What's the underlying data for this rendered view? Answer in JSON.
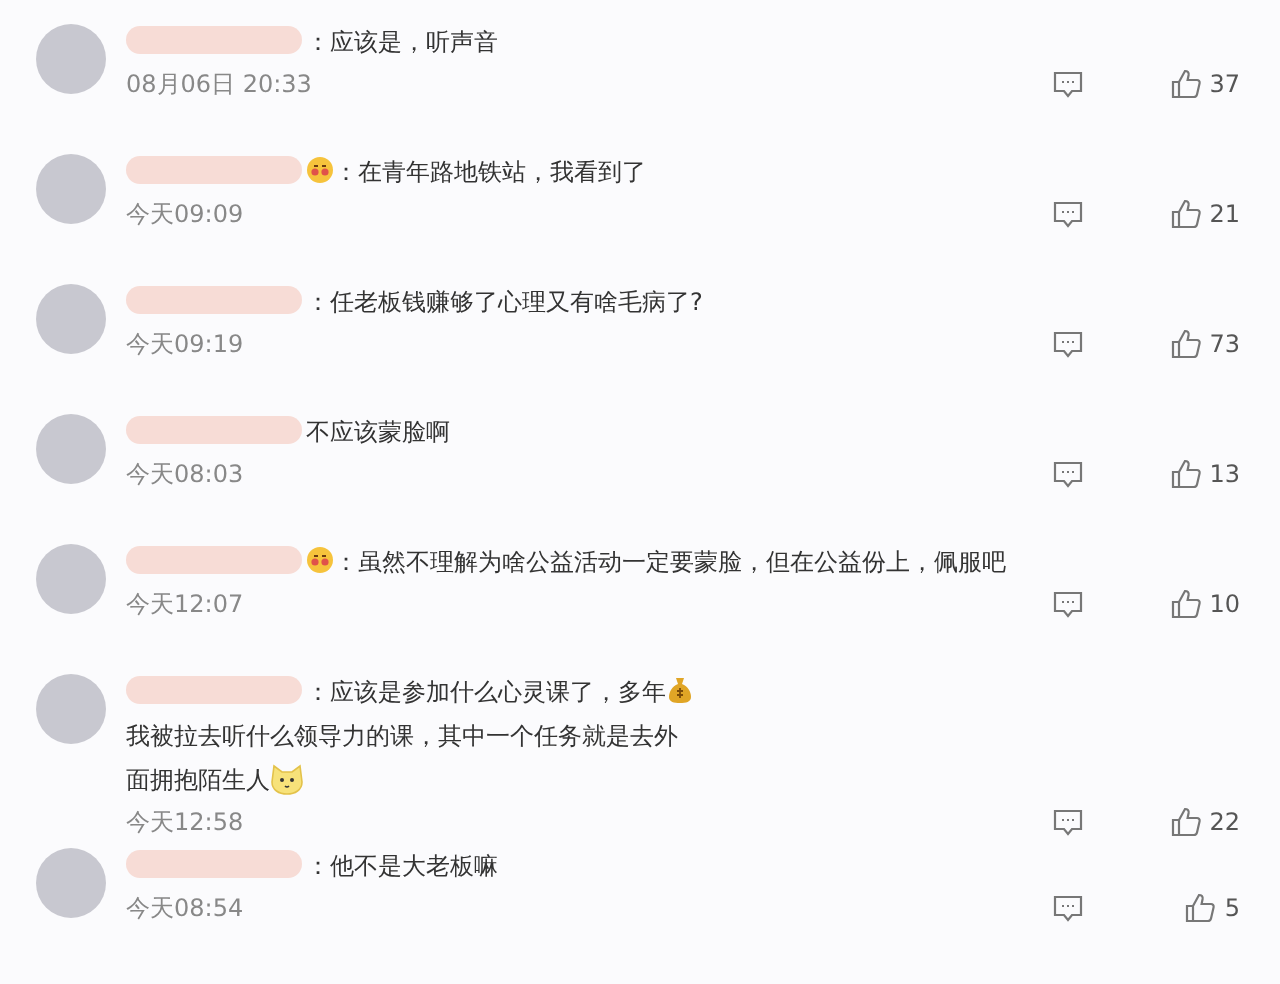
{
  "comments": [
    {
      "body": [
        {
          "kind": "text",
          "text": "：应该是，听声音"
        }
      ],
      "time": "08月06日 20:33",
      "likes": "37"
    },
    {
      "body": [
        {
          "kind": "blush"
        },
        {
          "kind": "text",
          "text": "：在青年路地铁站，我看到了"
        }
      ],
      "time": "今天09:09",
      "likes": "21"
    },
    {
      "body": [
        {
          "kind": "text",
          "text": "：任老板钱赚够了心理又有啥毛病了?"
        }
      ],
      "time": "今天09:19",
      "likes": "73"
    },
    {
      "body": [
        {
          "kind": "text",
          "text": "不应该蒙脸啊"
        }
      ],
      "time": "今天08:03",
      "likes": "13"
    },
    {
      "body": [
        {
          "kind": "blush"
        },
        {
          "kind": "text",
          "text": "：虽然不理解为啥公益活动一定要蒙脸，但在公益份上，佩服吧"
        }
      ],
      "time": "今天12:07",
      "likes": "10"
    },
    {
      "body": [
        {
          "kind": "text",
          "text": "：应该是参加什么心灵课了，多年"
        },
        {
          "kind": "bag"
        },
        {
          "kind": "text",
          "text": "我被拉去听什么领导力的课，其中一个任务就是去外"
        },
        {
          "kind": "break"
        },
        {
          "kind": "text",
          "text": "面拥抱陌生人"
        },
        {
          "kind": "cat"
        }
      ],
      "time": "今天12:58",
      "likes": "22"
    },
    {
      "body": [
        {
          "kind": "text",
          "text": "：他不是大老板嘛"
        }
      ],
      "time": "今天08:54",
      "likes": "5"
    }
  ]
}
